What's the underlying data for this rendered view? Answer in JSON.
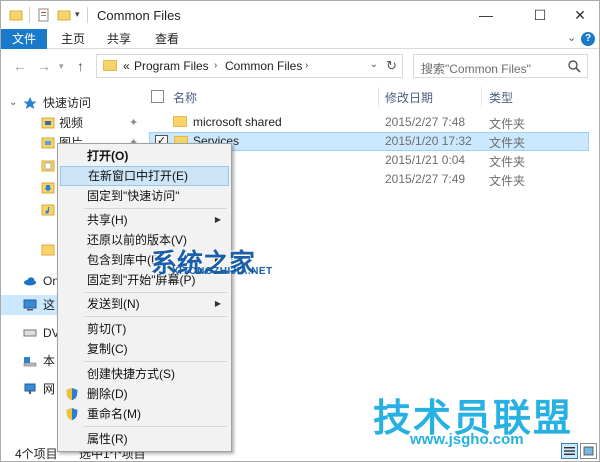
{
  "window": {
    "title": "Common Files",
    "controls": {
      "minimize": "—",
      "maximize": "☐",
      "close": "✕"
    }
  },
  "ribbon": {
    "tabs": [
      "文件",
      "主页",
      "共享",
      "查看"
    ],
    "active_tab": "文件",
    "expand_glyph": "⌄",
    "help": "?"
  },
  "address_bar": {
    "prefix": "«",
    "path": [
      "Program Files",
      "Common Files"
    ],
    "chevron": "›"
  },
  "search": {
    "placeholder": "搜索\"Common Files\""
  },
  "sidebar": {
    "items": [
      {
        "label": "快速访问",
        "icon": "star-icon"
      },
      {
        "label": "视频",
        "icon": "video-folder-icon",
        "pinned": true
      },
      {
        "label": "图片",
        "icon": "pictures-folder-icon",
        "pinned": true
      },
      {
        "label": "",
        "icon": "documents-folder-icon"
      },
      {
        "label": "",
        "icon": "downloads-folder-icon"
      },
      {
        "label": "",
        "icon": "music-folder-icon"
      },
      {
        "label": "",
        "icon": "folder-icon"
      },
      {
        "label": "On",
        "icon": "onedrive-icon"
      },
      {
        "label": "这",
        "icon": "this-pc-icon"
      },
      {
        "label": "DV",
        "icon": "dvd-drive-icon"
      },
      {
        "label": "本",
        "icon": "local-disk-icon"
      },
      {
        "label": "网",
        "icon": "network-icon"
      }
    ]
  },
  "file_list": {
    "columns": [
      "名称",
      "修改日期",
      "类型"
    ],
    "rows": [
      {
        "name": "microsoft shared",
        "modified": "2015/2/27 7:48",
        "type": "文件夹",
        "selected": false
      },
      {
        "name": "Services",
        "modified": "2015/1/20 17:32",
        "type": "文件夹",
        "selected": true
      },
      {
        "name": "",
        "modified": "2015/1/21 0:04",
        "type": "文件夹",
        "selected": false
      },
      {
        "name": "",
        "modified": "2015/2/27 7:49",
        "type": "文件夹",
        "selected": false
      }
    ]
  },
  "context_menu": {
    "items": [
      {
        "label": "打开(O)",
        "bold": true
      },
      {
        "label": "在新窗口中打开(E)",
        "highlighted": true
      },
      {
        "label": "固定到\"快速访问\""
      },
      {
        "label": "共享(H)",
        "submenu": true
      },
      {
        "label": "还原以前的版本(V)"
      },
      {
        "label": "包含到库中(I)",
        "submenu": true
      },
      {
        "label": "固定到\"开始\"屏幕(P)"
      },
      {
        "label": "发送到(N)",
        "submenu": true
      },
      {
        "label": "剪切(T)"
      },
      {
        "label": "复制(C)"
      },
      {
        "label": "创建快捷方式(S)"
      },
      {
        "label": "删除(D)",
        "icon": "shield-icon"
      },
      {
        "label": "重命名(M)",
        "icon": "shield-icon"
      },
      {
        "label": "属性(R)"
      }
    ],
    "submenu_arrow": "▶"
  },
  "statusbar": {
    "item_count": "4个项目",
    "selected": "选中1个项目"
  },
  "watermarks": {
    "logo1": "系统之家",
    "logo1_sub": "XITONGZHIJIA.NET",
    "logo2": "技术员联盟",
    "logo2_sub": "www.jsgho.com"
  },
  "colors": {
    "accent": "#1979ca",
    "selection": "#cce8ff",
    "folder": "#f7d36c",
    "menu_bg": "#f2f2f2",
    "menu_highlight": "#cde5f7"
  }
}
